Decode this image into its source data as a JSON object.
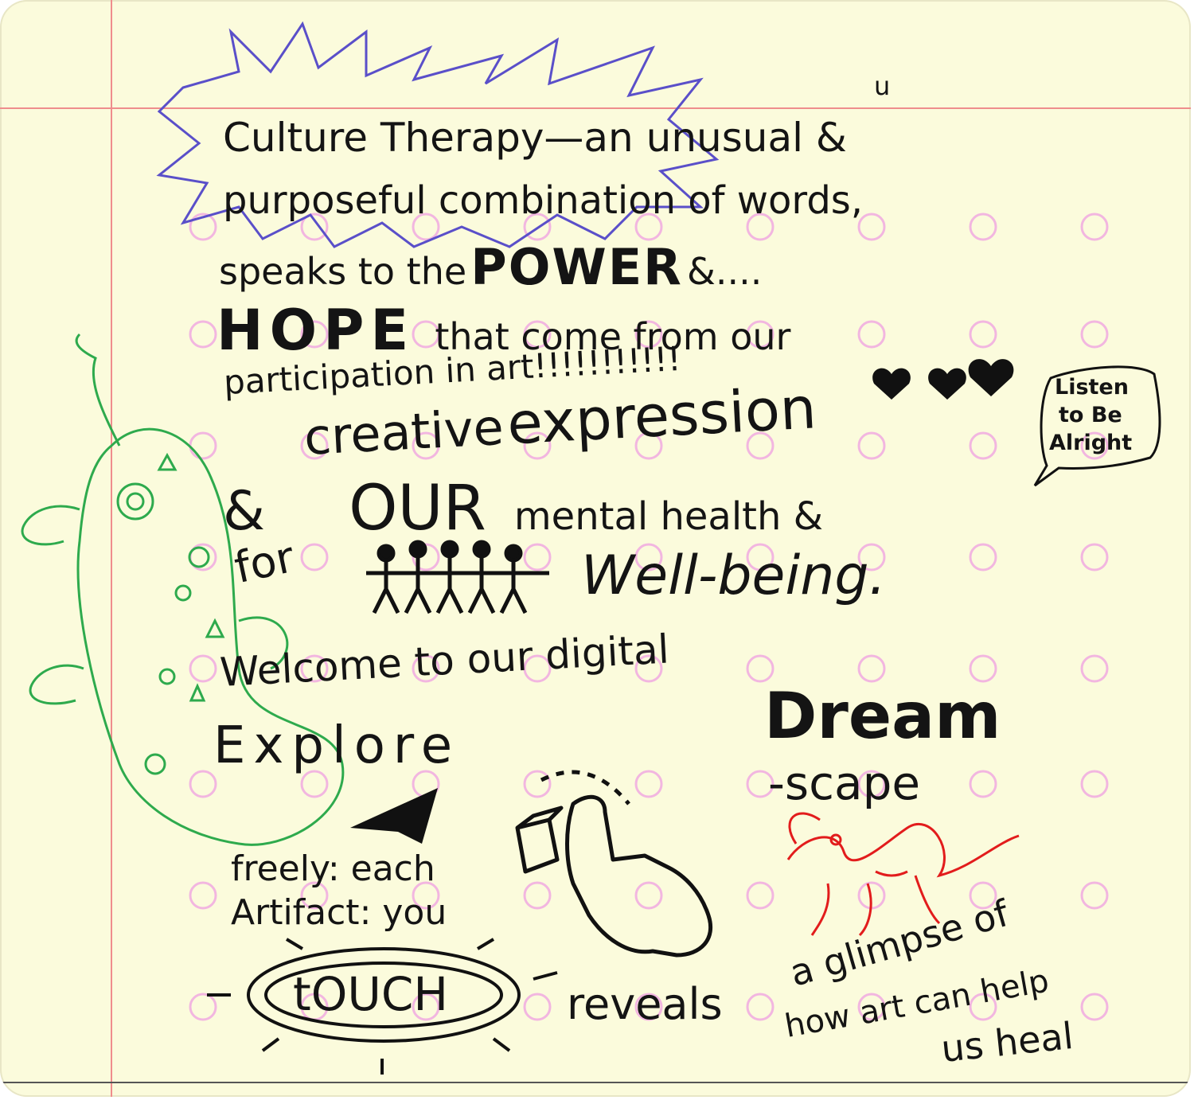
{
  "notecard": {
    "lines": {
      "line1a": "Culture Therapy—an unusual &",
      "line1_insert": "u",
      "line2": "purposeful combination of words,",
      "line3a": "speaks to the",
      "line3b": "POWER",
      "line3c": "&....",
      "line4a": "HOPE",
      "line4b": "that come from our",
      "line5": "participation in art!!!!!!!!!!!",
      "line6a": "creative",
      "line6b": "expression",
      "line7a": "&",
      "line7b": "OUR",
      "line7c": "mental health &",
      "line8a": "for",
      "line8b": "Well-being.",
      "welcome": "Welcome to our digital",
      "dream": "Dream",
      "scape": "-scape",
      "explore": "Explore",
      "freely": "freely: each",
      "artifact": "Artifact: you",
      "touch": "tOUCH",
      "reveals": "reveals",
      "glimpse": "a glimpse of",
      "howart": "how art can help",
      "usheal": "us heal"
    },
    "bubble": {
      "line1": "Listen",
      "line2": "to Be",
      "line3": "Alright"
    },
    "colors": {
      "paper": "#fbfbdc",
      "ink": "#141414",
      "margin_line": "#ef8d8d",
      "ring_pink": "#f2b6e0",
      "blue_star": "#5a4fc9",
      "green_creature": "#2eaa4d",
      "red_creature": "#e21c1c"
    }
  }
}
